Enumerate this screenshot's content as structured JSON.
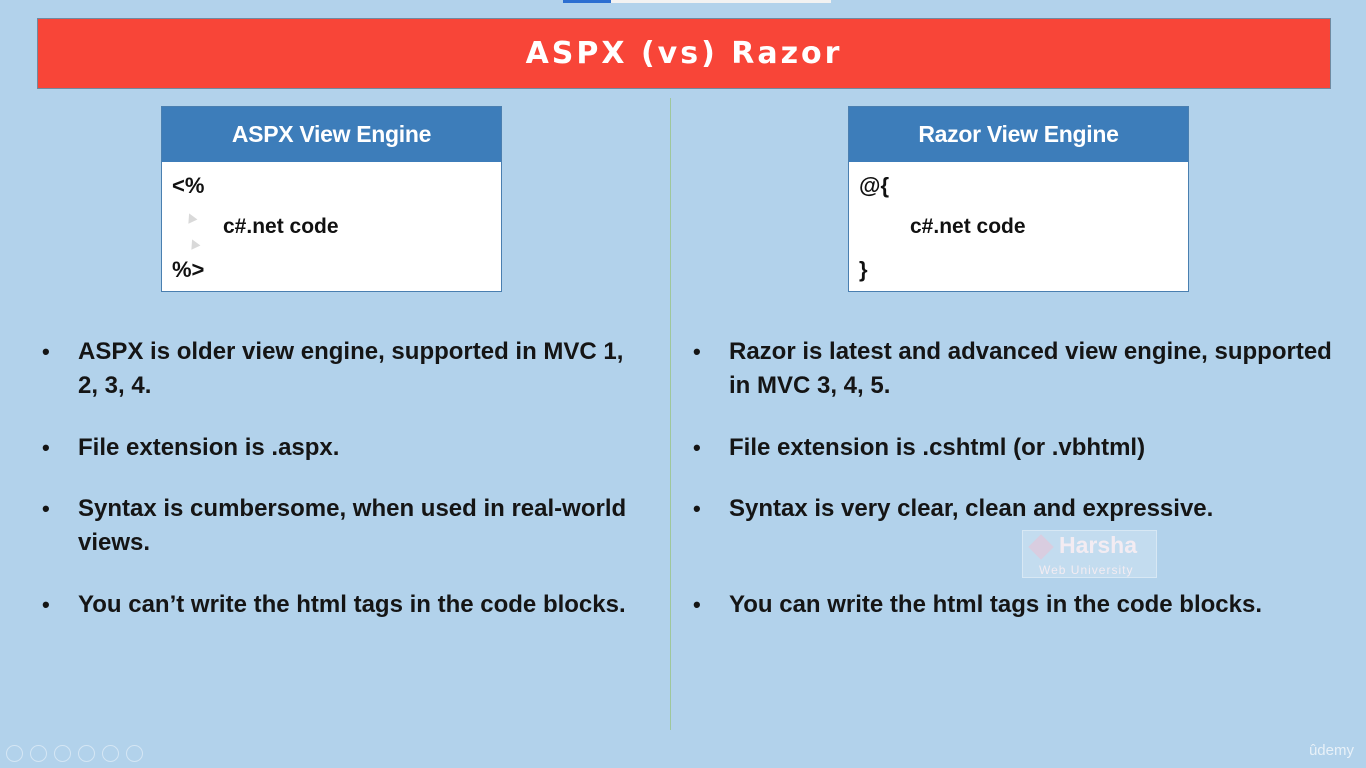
{
  "slide": {
    "title": "ASPX (vs) Razor"
  },
  "left_panel": {
    "header": "ASPX View Engine",
    "code_open": "<%",
    "code_body": "c#.net code",
    "code_close": "%>",
    "bullets": [
      "ASPX is older view engine, supported in MVC 1, 2, 3, 4.",
      "File extension is .aspx.",
      "Syntax is cumbersome, when used in real-world views.",
      "You can’t write the html tags in the code blocks."
    ]
  },
  "right_panel": {
    "header": "Razor View Engine",
    "code_open": "@{",
    "code_body": "c#.net code",
    "code_close": "}",
    "bullets": [
      "Razor is latest and advanced view engine, supported in MVC 3, 4, 5.",
      "File extension is .cshtml (or .vbhtml)",
      "Syntax is very clear, clean and expressive.",
      "You can write the html tags in the code blocks."
    ]
  },
  "watermark": {
    "name": "Harsha",
    "sub": "Web University"
  },
  "brand": "ûdemy",
  "bullet_glyph": "•",
  "colors": {
    "title_bar": "#f84538",
    "engine_header": "#3d7dba",
    "background": "#b2d2eb"
  }
}
